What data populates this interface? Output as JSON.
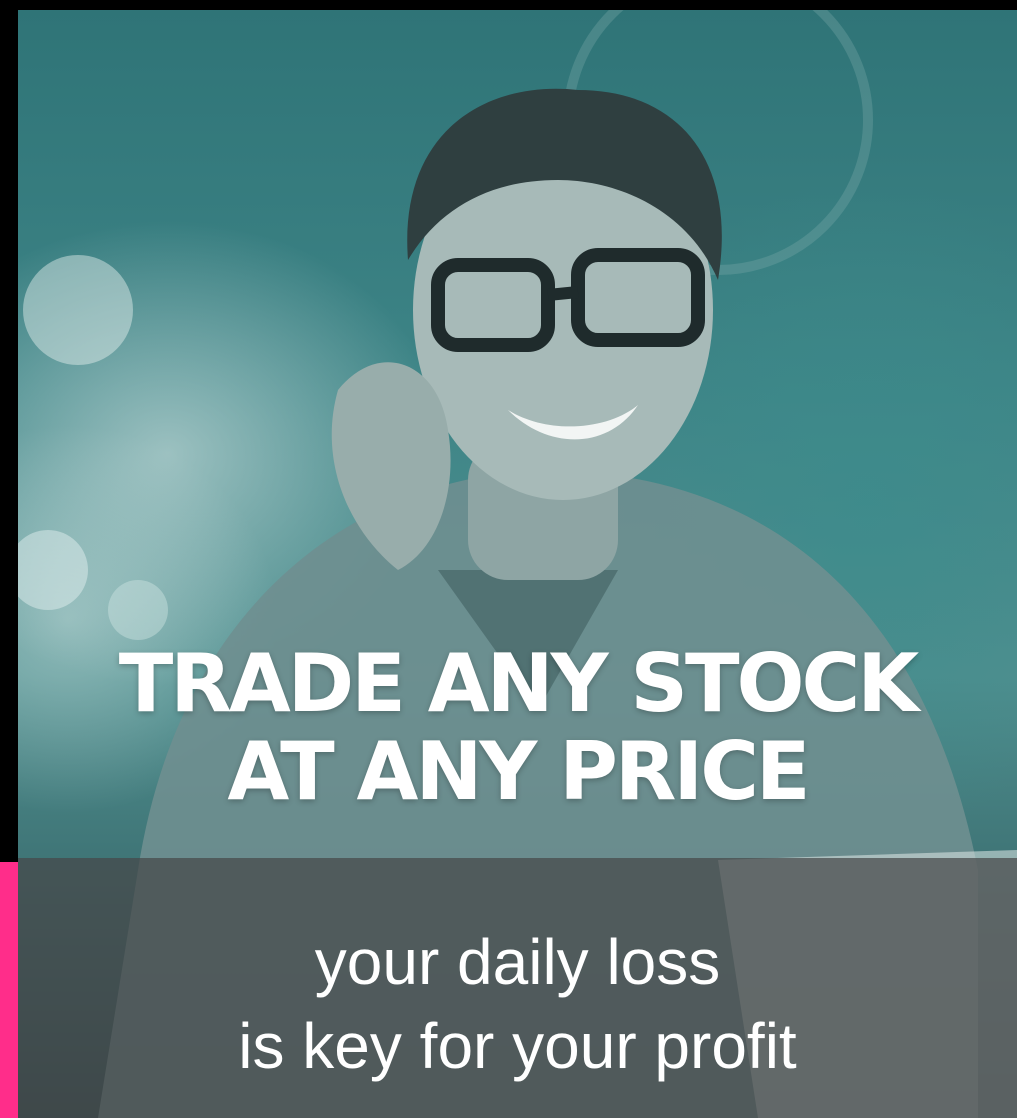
{
  "headline": {
    "line1": "TRADE ANY STOCK",
    "line2": "AT ANY PRICE"
  },
  "caption": {
    "line1": "your daily loss",
    "line2": "is key for your profit"
  },
  "colors": {
    "accent": "#ff2d8a",
    "tint": "#3e8587",
    "text": "#ffffff"
  },
  "photo": {
    "subject": "smiling man with glasses"
  }
}
